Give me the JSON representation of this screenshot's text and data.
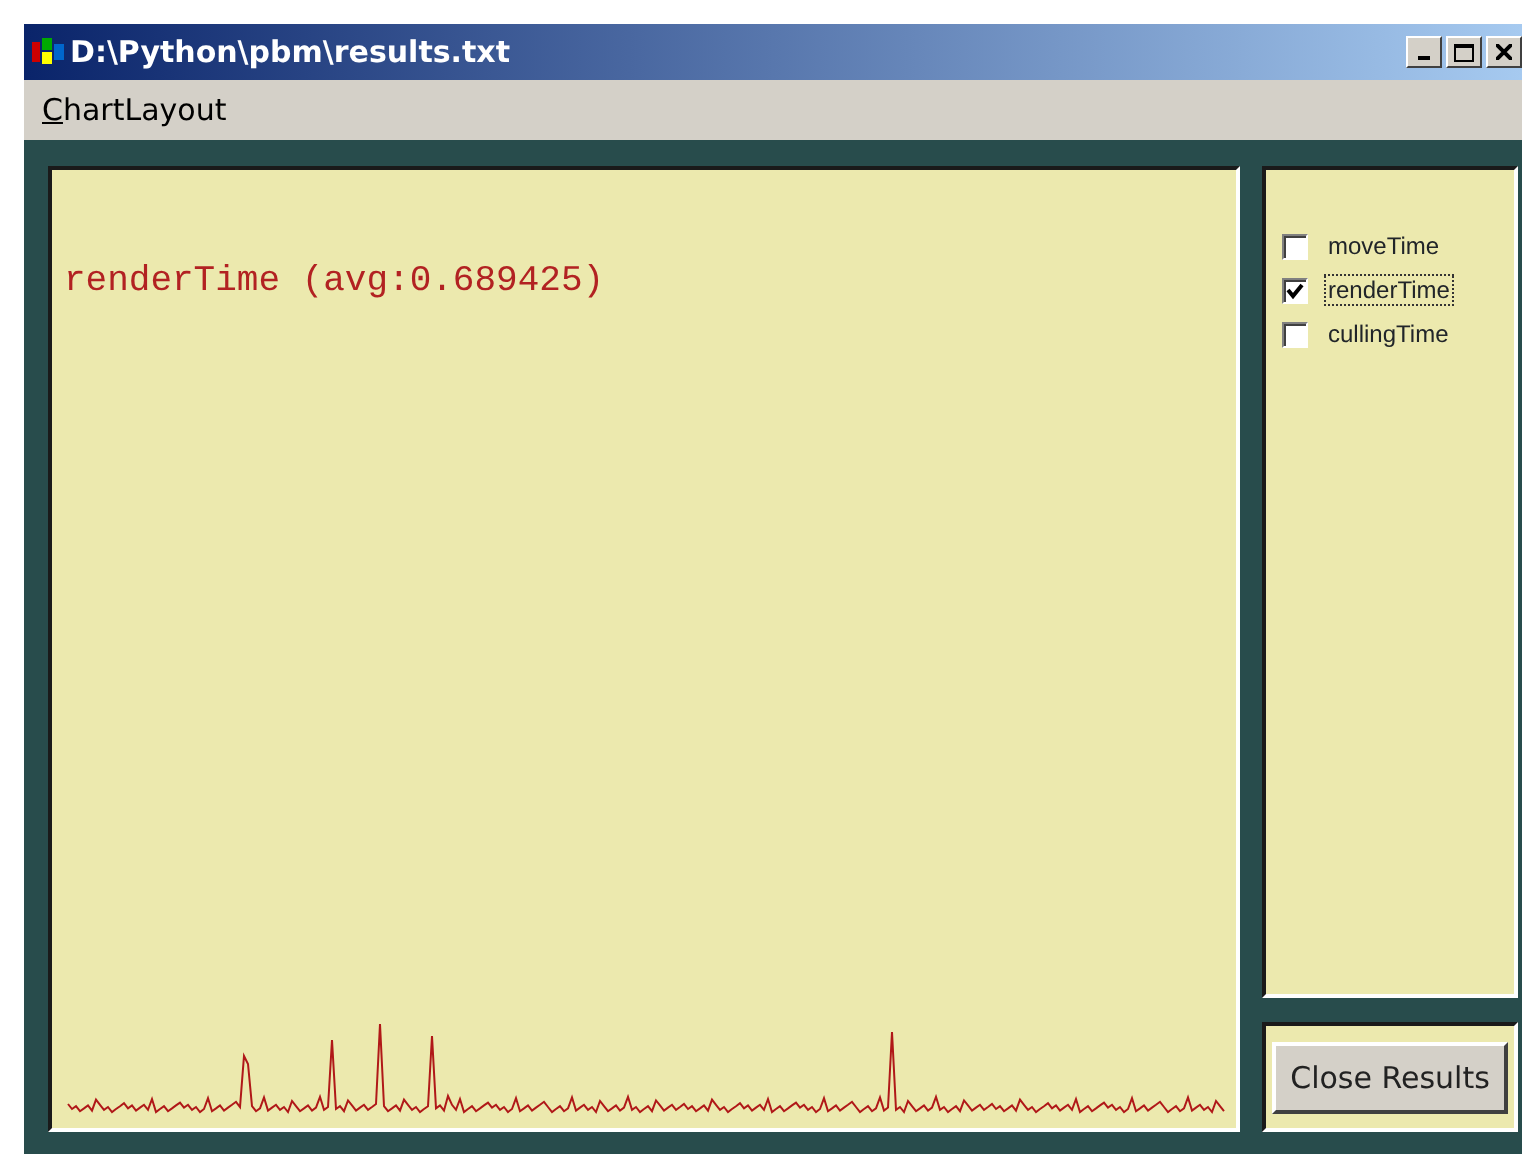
{
  "window": {
    "title": "D:\\Python\\pbm\\results.txt"
  },
  "menu": [
    {
      "label": "ChartLayout",
      "first_letter_underlined": true
    }
  ],
  "chart": {
    "caption": "renderTime (avg:0.689425)"
  },
  "series": [
    {
      "label": "moveTime",
      "checked": false,
      "focused": false
    },
    {
      "label": "renderTime",
      "checked": true,
      "focused": true
    },
    {
      "label": "cullingTime",
      "checked": false,
      "focused": false
    }
  ],
  "buttons": [
    {
      "label": "Close Results"
    }
  ]
}
